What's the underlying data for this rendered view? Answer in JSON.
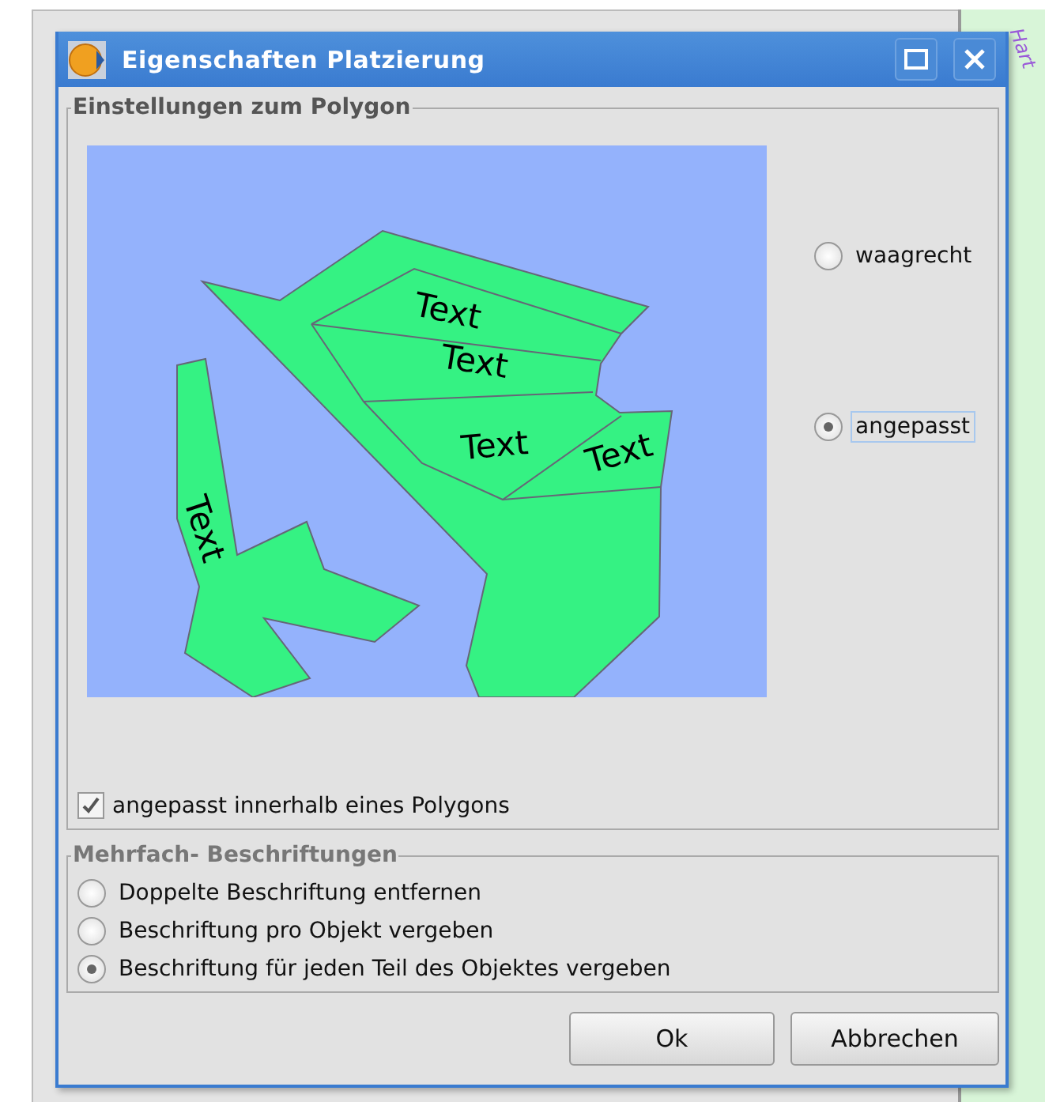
{
  "background_map_label": "Hart",
  "dialog": {
    "title": "Eigenschaften Platzierung"
  },
  "polygon_group": {
    "legend": "Einstellungen zum Polygon",
    "preview_labels": [
      "Text",
      "Text",
      "Text",
      "Text",
      "Text"
    ],
    "orientation_options": [
      {
        "label": "waagrecht",
        "selected": false
      },
      {
        "label": "angepasst",
        "selected": true
      }
    ],
    "inside_polygon": {
      "label": "angepasst innerhalb eines Polygons",
      "checked": true
    }
  },
  "multi_group": {
    "legend": "Mehrfach- Beschriftungen",
    "options": [
      {
        "label": "Doppelte Beschriftung entfernen",
        "selected": false
      },
      {
        "label": "Beschriftung pro Objekt vergeben",
        "selected": false
      },
      {
        "label": "Beschriftung für jeden Teil des Objektes vergeben",
        "selected": true
      }
    ]
  },
  "buttons": [
    "Ok",
    "Abbrechen"
  ]
}
